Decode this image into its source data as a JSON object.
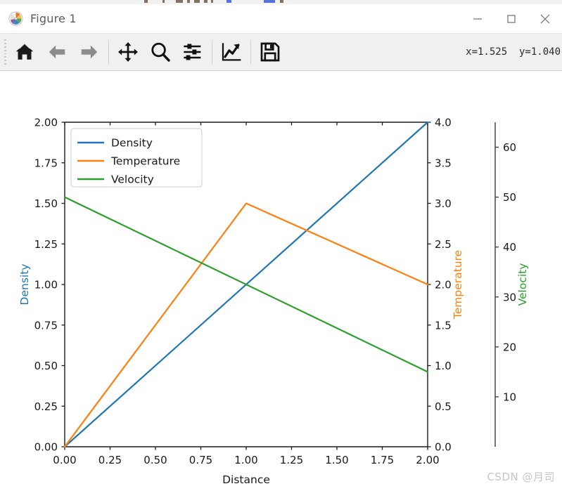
{
  "window": {
    "title": "Figure 1",
    "app_icon": "matplotlib-logo-icon",
    "controls": {
      "minimize": "minimize-icon",
      "maximize": "maximize-icon",
      "close": "close-icon"
    }
  },
  "toolbar": {
    "buttons": [
      {
        "name": "home",
        "icon": "home-icon",
        "tooltip": "Reset original view"
      },
      {
        "name": "back",
        "icon": "arrow-left-icon",
        "tooltip": "Back to previous view"
      },
      {
        "name": "forward",
        "icon": "arrow-right-icon",
        "tooltip": "Forward to next view"
      },
      {
        "name": "pan",
        "icon": "move-cross-icon",
        "tooltip": "Pan axes with left mouse, zoom with right"
      },
      {
        "name": "zoom",
        "icon": "magnifier-icon",
        "tooltip": "Zoom to rectangle"
      },
      {
        "name": "configure-subplots",
        "icon": "sliders-icon",
        "tooltip": "Configure subplots"
      },
      {
        "name": "edit-axis",
        "icon": "chart-line-icon",
        "tooltip": "Edit axis, curve and image parameters"
      },
      {
        "name": "save",
        "icon": "floppy-disk-icon",
        "tooltip": "Save the figure"
      }
    ],
    "coordinates": "x=1.525  y=1.040"
  },
  "watermark": "CSDN @月司",
  "chart_data": {
    "type": "line",
    "title": "",
    "xlabel": "Distance",
    "xlim": [
      0.0,
      2.0
    ],
    "xticks": [
      "0.00",
      "0.25",
      "0.50",
      "0.75",
      "1.00",
      "1.25",
      "1.50",
      "1.75",
      "2.00"
    ],
    "xtick_values": [
      0.0,
      0.25,
      0.5,
      0.75,
      1.0,
      1.25,
      1.5,
      1.75,
      2.0
    ],
    "grid": false,
    "legend_position": "upper left",
    "axes": [
      {
        "id": "density",
        "label": "Density",
        "color": "#1f77b4",
        "side": "left",
        "ylim": [
          0.0,
          2.0
        ],
        "yticks": [
          "0.00",
          "0.25",
          "0.50",
          "0.75",
          "1.00",
          "1.25",
          "1.50",
          "1.75",
          "2.00"
        ],
        "ytick_values": [
          0.0,
          0.25,
          0.5,
          0.75,
          1.0,
          1.25,
          1.5,
          1.75,
          2.0
        ]
      },
      {
        "id": "temperature",
        "label": "Temperature",
        "color": "#ff7f0e",
        "side": "right",
        "offset": 0,
        "ylim": [
          0.0,
          4.0
        ],
        "yticks": [
          "0.0",
          "0.5",
          "1.0",
          "1.5",
          "2.0",
          "2.5",
          "3.0",
          "3.5",
          "4.0"
        ],
        "ytick_values": [
          0.0,
          0.5,
          1.0,
          1.5,
          2.0,
          2.5,
          3.0,
          3.5,
          4.0
        ]
      },
      {
        "id": "velocity",
        "label": "Velocity",
        "color": "#2ca02c",
        "side": "right",
        "offset": 90,
        "ylim": [
          0,
          65
        ],
        "yticks": [
          "10",
          "20",
          "30",
          "40",
          "50",
          "60"
        ],
        "ytick_values": [
          10,
          20,
          30,
          40,
          50,
          60
        ]
      }
    ],
    "series": [
      {
        "name": "Density",
        "axis": "density",
        "color": "#1f77b4",
        "x": [
          0.0,
          2.0
        ],
        "y": [
          0.0,
          2.0
        ]
      },
      {
        "name": "Temperature",
        "axis": "temperature",
        "color": "#ff7f0e",
        "x": [
          0.0,
          1.0,
          2.0
        ],
        "y": [
          0.0,
          3.0,
          2.0
        ]
      },
      {
        "name": "Velocity",
        "axis": "velocity",
        "color": "#2ca02c",
        "x": [
          0.0,
          2.0
        ],
        "y": [
          50,
          15
        ]
      }
    ],
    "legend": [
      "Density",
      "Temperature",
      "Velocity"
    ]
  }
}
